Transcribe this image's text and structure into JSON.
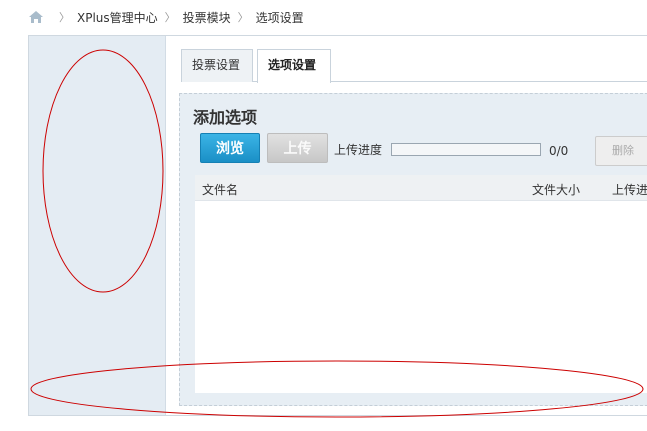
{
  "breadcrumb": {
    "items": [
      "XPlus管理中心",
      "投票模块",
      "选项设置"
    ]
  },
  "tabs": [
    {
      "label": "投票设置",
      "active": false
    },
    {
      "label": "选项设置",
      "active": true
    }
  ],
  "panel": {
    "title": "添加选项",
    "browse_label": "浏览",
    "upload_label": "上传",
    "progress_label": "上传进度",
    "progress_value": 0,
    "progress_count": "0/0",
    "delete_label": "删除"
  },
  "file_table": {
    "columns": [
      "文件名",
      "文件大小",
      "上传进度"
    ],
    "rows": []
  },
  "colors": {
    "browse_button": "#1a8fc6",
    "sidebar_bg": "#e4ecf3",
    "annotation": "#cc0000"
  }
}
